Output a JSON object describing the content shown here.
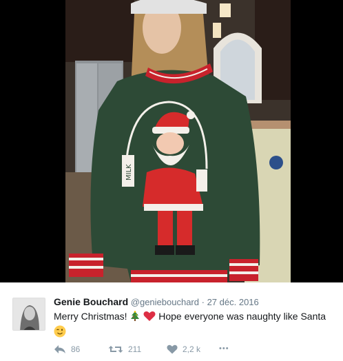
{
  "tweet": {
    "author_name": "Genie Bouchard",
    "handle": "@geniebouchard",
    "separator": "·",
    "date": "27 déc. 2016",
    "text_part1": "Merry Christmas!",
    "text_part2": "Hope everyone was naughty like Santa",
    "emojis": [
      "christmas-tree",
      "red-heart",
      "winking-face"
    ]
  },
  "photo": {
    "sweater_text": "MILK",
    "colors": {
      "sweater": "#2d4a36",
      "stripe_red": "#c8222c",
      "santa_red": "#d62b2b",
      "white": "#f4f0ea"
    }
  },
  "actions": {
    "reply_count": "86",
    "retweet_count": "211",
    "like_count": "2,2 k",
    "more_label": "•••"
  },
  "colors": {
    "name": "#14171a",
    "meta": "#657786",
    "icon": "#8899a6"
  }
}
